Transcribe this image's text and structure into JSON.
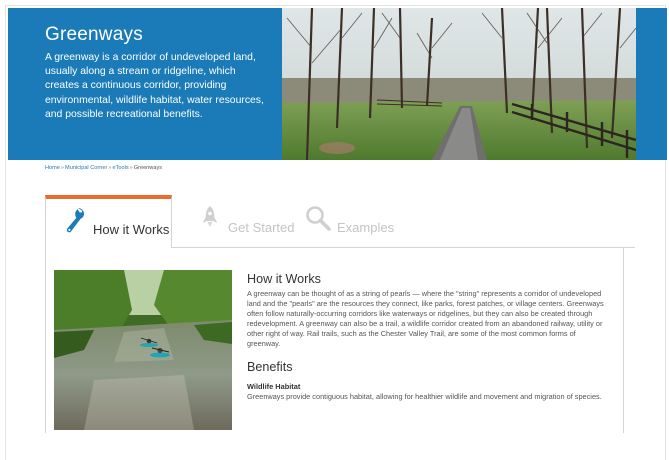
{
  "hero": {
    "title": "Greenways",
    "description": "A greenway is a corridor of undeveloped land, usually along a stream or ridgeline, which creates a continuous corridor, providing environmental, wildlife habitat, water resources, and possible recreational benefits."
  },
  "breadcrumb": {
    "items": [
      "Home",
      "Municipal Corner",
      "eTools"
    ],
    "separator": "»",
    "current": "Greenways"
  },
  "tabs": [
    {
      "label": "How it Works",
      "icon": "wrench-icon",
      "active": true
    },
    {
      "label": "Get Started",
      "icon": "rocket-icon",
      "active": false
    },
    {
      "label": "Examples",
      "icon": "magnifier-icon",
      "active": false
    }
  ],
  "content": {
    "heading": "How it Works",
    "body": "A greenway can be thought of as a string of pearls — where the \"string\" represents a corridor of undeveloped land and the \"pearls\" are the resources they connect, like parks, forest patches, or village centers. Greenways often follow naturally-occurring corridors like waterways or ridgelines, but they can also be created through redevelopment. A greenway can also be a trail, a wildlife corridor created from an abandoned railway, utility or other right of way. Rail trails, such as the Chester Valley Trail, are some of the most common forms of greenway.",
    "benefits_heading": "Benefits",
    "benefits": [
      {
        "title": "Wildlife Habitat",
        "text": "Greenways provide contiguous habitat, allowing for healthier wildlife and movement and migration of species."
      }
    ]
  },
  "colors": {
    "hero_background": "#1a7bb8",
    "active_tab_accent": "#e96d2b",
    "link": "#2a78b5",
    "inactive_tab_text": "#c4c4c4"
  }
}
